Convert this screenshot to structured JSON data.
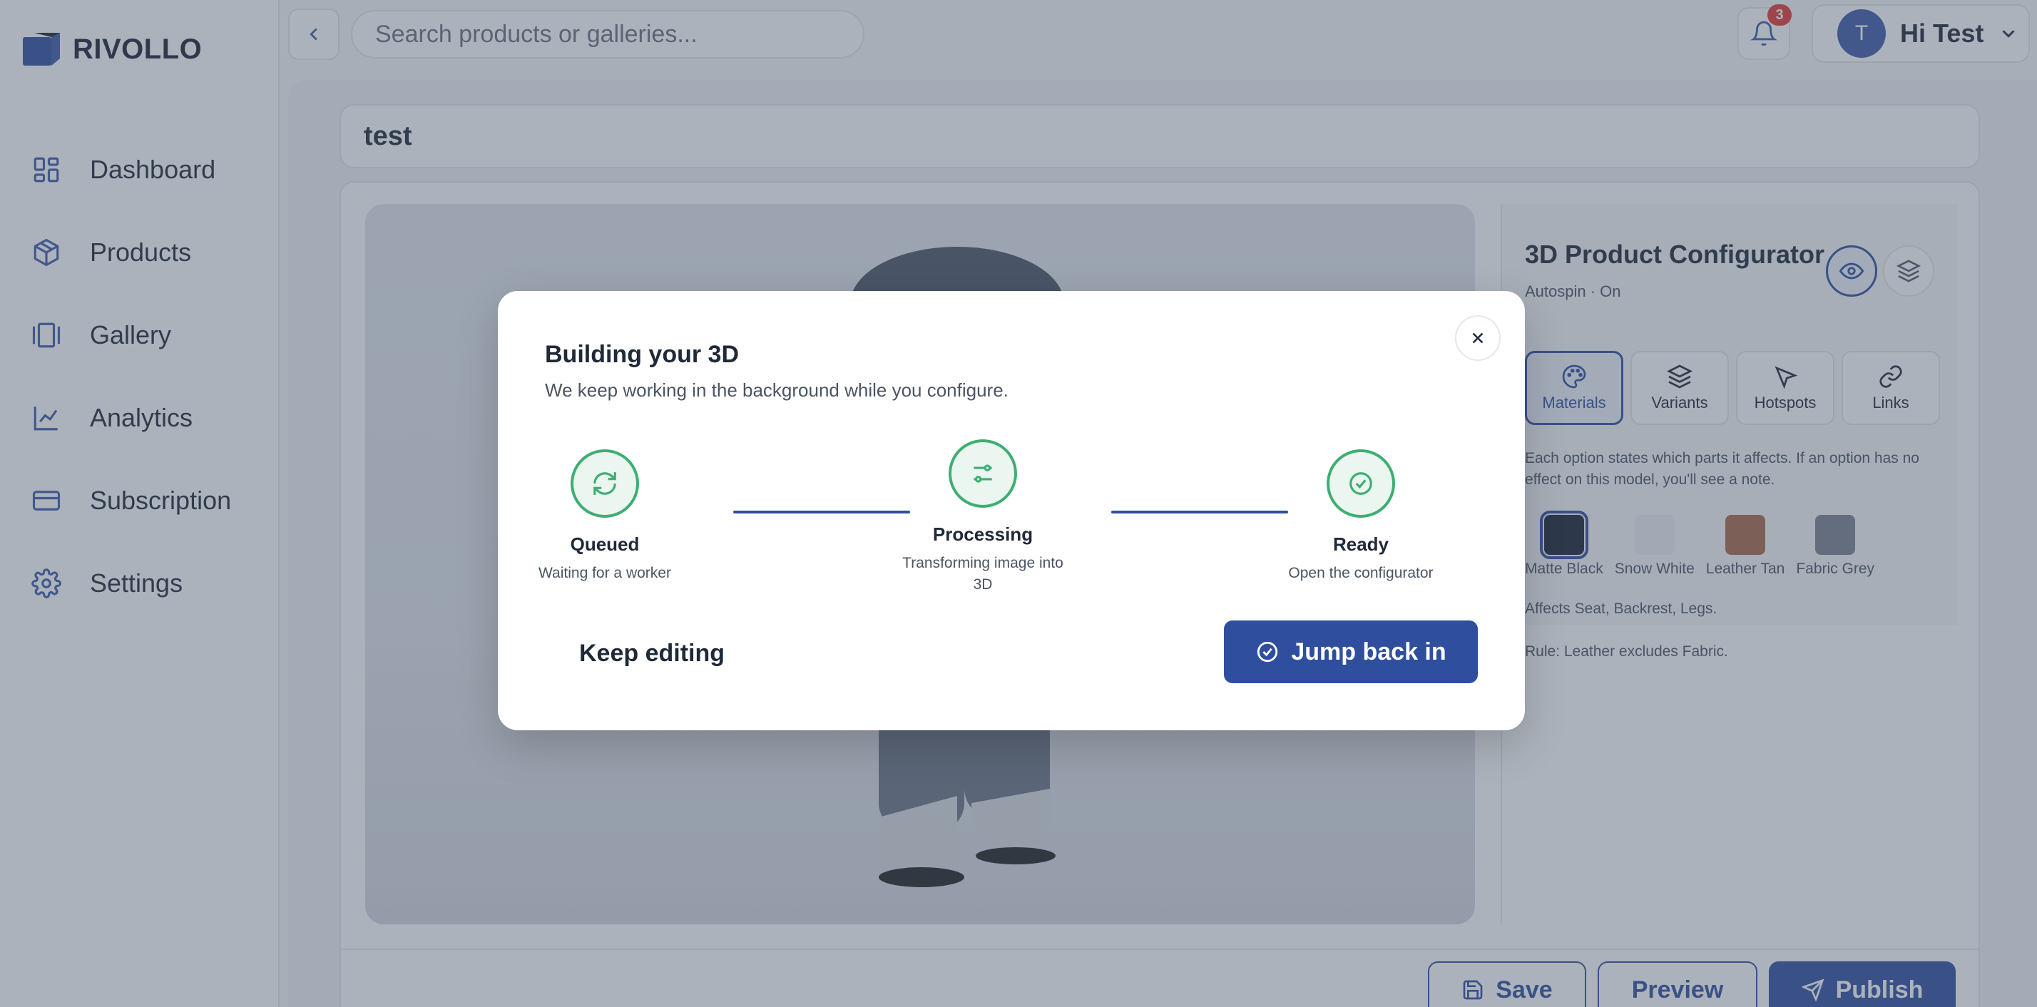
{
  "brand": {
    "name": "RIVOLLO"
  },
  "sidebar": {
    "items": [
      {
        "label": "Dashboard",
        "icon": "dashboard-icon"
      },
      {
        "label": "Products",
        "icon": "box-icon"
      },
      {
        "label": "Gallery",
        "icon": "gallery-icon"
      },
      {
        "label": "Analytics",
        "icon": "analytics-icon"
      },
      {
        "label": "Subscription",
        "icon": "card-icon"
      },
      {
        "label": "Settings",
        "icon": "gear-icon"
      }
    ]
  },
  "topbar": {
    "search_placeholder": "Search products or galleries...",
    "notification_count": "3",
    "avatar_initial": "T",
    "user_greeting": "Hi Test"
  },
  "page": {
    "title": "test"
  },
  "config": {
    "title": "3D Product Configurator",
    "subtitle": "Autospin · On",
    "tabs": [
      {
        "label": "Materials",
        "active": true
      },
      {
        "label": "Variants",
        "active": false
      },
      {
        "label": "Hotspots",
        "active": false
      },
      {
        "label": "Links",
        "active": false
      }
    ],
    "description": "Each option states which parts it affects. If an option has no effect on this model, you'll see a note.",
    "swatches": [
      {
        "label": "Matte Black",
        "color": "#1b2233",
        "selected": true
      },
      {
        "label": "Snow White",
        "color": "#eceef2",
        "selected": false
      },
      {
        "label": "Leather Tan",
        "color": "#a86b4a",
        "selected": false
      },
      {
        "label": "Fabric Grey",
        "color": "#7b8190",
        "selected": false
      }
    ],
    "affects": "Affects Seat, Backrest, Legs.",
    "rule": "Rule: Leather excludes Fabric."
  },
  "actions": {
    "save": "Save",
    "preview": "Preview",
    "publish": "Publish"
  },
  "modal": {
    "title": "Building your 3D",
    "subtitle": "We keep working in the background while you configure.",
    "steps": [
      {
        "label": "Queued",
        "desc": "Waiting for a worker",
        "icon": "refresh-icon"
      },
      {
        "label": "Processing",
        "desc": "Transforming image into 3D",
        "icon": "sliders-icon"
      },
      {
        "label": "Ready",
        "desc": "Open the configurator",
        "icon": "check-circle-icon"
      }
    ],
    "keep_editing": "Keep editing",
    "jump_back": "Jump back in"
  },
  "colors": {
    "primary": "#2f4f9e",
    "success": "#3fae73",
    "badge": "#e53935"
  }
}
